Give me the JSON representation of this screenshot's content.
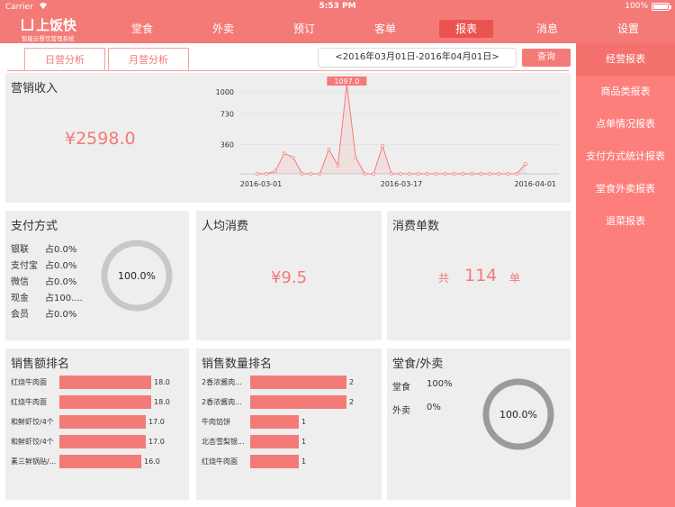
{
  "status_bar": {
    "carrier": "Carrier",
    "time": "5:53 PM",
    "battery": "100%"
  },
  "app": {
    "logo_text": "上饭快",
    "logo_subtitle": "智能云餐饮管理系统"
  },
  "nav": {
    "items": [
      {
        "label": "堂食"
      },
      {
        "label": "外卖"
      },
      {
        "label": "预订"
      },
      {
        "label": "客单"
      },
      {
        "label": "报表",
        "active": true
      },
      {
        "label": "消息"
      },
      {
        "label": "设置"
      }
    ]
  },
  "sidebar": {
    "items": [
      {
        "label": "经营报表",
        "active": true
      },
      {
        "label": "商品类报表"
      },
      {
        "label": "点单情况报表"
      },
      {
        "label": "支付方式统计报表"
      },
      {
        "label": "堂食外卖报表"
      },
      {
        "label": "退菜报表"
      }
    ]
  },
  "tabs": {
    "daily": "日营分析",
    "monthly": "月营分析"
  },
  "date_range": "<2016年03月01日-2016年04月01日>",
  "query_button": "查询",
  "revenue": {
    "title": "营销收入",
    "amount": "¥2598.0",
    "peak_label": "1097.0"
  },
  "chart_data": {
    "type": "line",
    "x_ticks": [
      "2016-03-01",
      "2016-03-17",
      "2016-04-01"
    ],
    "y_ticks": [
      "1000",
      "730",
      "360"
    ],
    "ylim": [
      0,
      1100
    ],
    "values": [
      0,
      0,
      30,
      250,
      200,
      0,
      0,
      0,
      300,
      100,
      1097,
      200,
      0,
      0,
      340,
      0,
      0,
      0,
      0,
      0,
      0,
      0,
      0,
      0,
      0,
      0,
      0,
      0,
      0,
      0,
      120
    ],
    "peak_index": 10
  },
  "payment": {
    "title": "支付方式",
    "rows": [
      {
        "name": "银联",
        "pct": "占0.0%"
      },
      {
        "name": "支付宝",
        "pct": "占0.0%"
      },
      {
        "name": "微信",
        "pct": "占0.0%"
      },
      {
        "name": "现金",
        "pct": "占100...."
      },
      {
        "name": "会员",
        "pct": "占0.0%"
      }
    ],
    "donut_label": "100.0%"
  },
  "per_capita": {
    "title": "人均消费",
    "amount": "¥9.5"
  },
  "orders": {
    "title": "消费单数",
    "prefix": "共",
    "count": "114",
    "suffix": "单"
  },
  "sales_amount_rank": {
    "title": "销售额排名",
    "items": [
      {
        "name": "红烧牛肉面",
        "value": "18.0",
        "num": 18
      },
      {
        "name": "红烧牛肉面",
        "value": "18.0",
        "num": 18
      },
      {
        "name": "和鲜虾饺/4个",
        "value": "17.0",
        "num": 17
      },
      {
        "name": "和鲜虾饺/4个",
        "value": "17.0",
        "num": 17
      },
      {
        "name": "素三鲜锅贴/...",
        "value": "16.0",
        "num": 16
      }
    ]
  },
  "sales_qty_rank": {
    "title": "销售数量排名",
    "items": [
      {
        "name": "2香浓酱肉...",
        "value": "2",
        "num": 2
      },
      {
        "name": "2香浓酱肉...",
        "value": "2",
        "num": 2
      },
      {
        "name": "牛肉馅饼",
        "value": "1",
        "num": 1
      },
      {
        "name": "北杏雪梨银...",
        "value": "1",
        "num": 1
      },
      {
        "name": "红烧牛肉面",
        "value": "1",
        "num": 1
      }
    ]
  },
  "dine_takeout": {
    "title": "堂食/外卖",
    "rows": [
      {
        "name": "堂食",
        "pct": "100%"
      },
      {
        "name": "外卖",
        "pct": "0%"
      }
    ],
    "donut_label": "100.0%"
  },
  "colors": {
    "accent": "#f47a77",
    "panel": "#eeeeee",
    "donut_pay": "#c8c8c8",
    "donut_dine": "#9b9b9b"
  }
}
